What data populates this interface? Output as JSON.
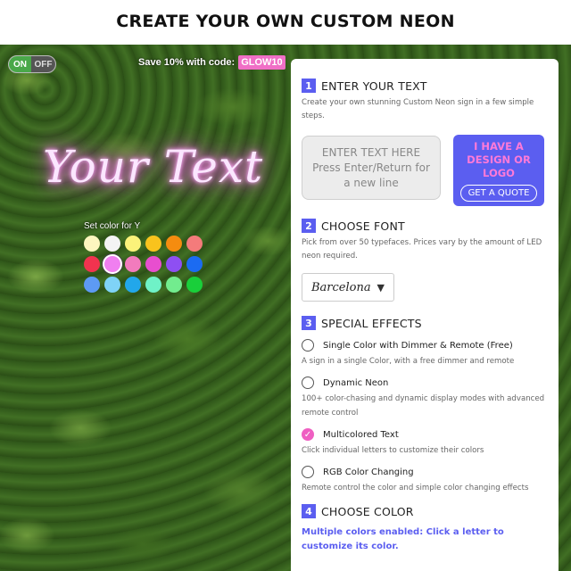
{
  "page": {
    "title": "CREATE YOUR OWN CUSTOM NEON"
  },
  "toggle": {
    "on_label": "ON",
    "off_label": "OFF"
  },
  "promo": {
    "text": "Save 10% with code:",
    "code": "GLOW10"
  },
  "preview": {
    "neon_text": "Your Text",
    "neon_color": "#ff7be8"
  },
  "color_picker": {
    "label": "Set color for Y",
    "swatches": [
      "#fdf6bf",
      "#f4f4f4",
      "#fbf27a",
      "#f9c31d",
      "#f58c0f",
      "#f47b7b",
      "#f1334f",
      "#f07ff0",
      "#f27bbd",
      "#e84ecf",
      "#8e4ff2",
      "#1b6bf2",
      "#5d9af4",
      "#7fd3f7",
      "#22a7ea",
      "#6ff2c7",
      "#72ec8e",
      "#19cf3a"
    ],
    "selected_index": 7
  },
  "panel": {
    "sections": [
      {
        "num": "1",
        "title": "ENTER YOUR TEXT",
        "desc": "Create your own stunning Custom Neon sign in a few simple steps."
      },
      {
        "num": "2",
        "title": "CHOOSE FONT",
        "desc": "Pick from over 50 typefaces. Prices vary by the amount of LED neon required."
      },
      {
        "num": "3",
        "title": "SPECIAL EFFECTS"
      },
      {
        "num": "4",
        "title": "CHOOSE COLOR"
      }
    ],
    "text_input": {
      "line1": "ENTER TEXT HERE",
      "line2": "Press Enter/Return for",
      "line3": "a new line"
    },
    "design_box": {
      "line1": "I HAVE A",
      "line2": "DESIGN OR",
      "line3": "LOGO",
      "button": "GET A QUOTE"
    },
    "font_select": {
      "value": "Barcelona"
    },
    "effects": [
      {
        "label": "Single Color with Dimmer & Remote (Free)",
        "desc": "A sign in a single Color, with a free dimmer and remote",
        "checked": false
      },
      {
        "label": "Dynamic Neon",
        "desc": "100+ color-chasing and dynamic display modes with advanced remote control",
        "checked": false
      },
      {
        "label": "Multicolored Text",
        "desc": "Click individual letters to customize their colors",
        "checked": true
      },
      {
        "label": "RGB Color Changing",
        "desc": "Remote control the color and simple color changing effects",
        "checked": false
      }
    ],
    "color_note": "Multiple colors enabled: Click a letter to customize its color."
  }
}
